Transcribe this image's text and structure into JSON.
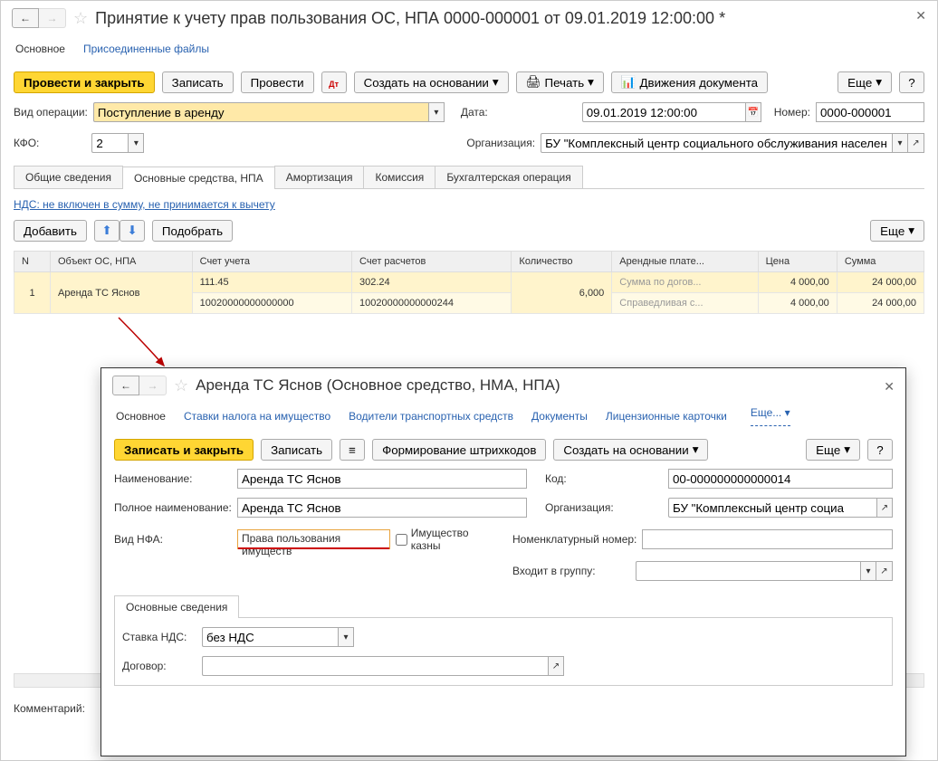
{
  "window": {
    "title": "Принятие к учету прав пользования ОС, НПА 0000-000001 от 09.01.2019 12:00:00 *",
    "nav_tabs": [
      "Основное",
      "Присоединенные файлы"
    ],
    "toolbar": {
      "post_close": "Провести и закрыть",
      "save": "Записать",
      "post": "Провести",
      "create_based": "Создать на основании",
      "print": "Печать",
      "movements": "Движения документа",
      "more": "Еще"
    },
    "fields": {
      "operation_type_label": "Вид операции:",
      "operation_type_value": "Поступление в аренду",
      "date_label": "Дата:",
      "date_value": "09.01.2019 12:00:00",
      "number_label": "Номер:",
      "number_value": "0000-000001",
      "kfo_label": "КФО:",
      "kfo_value": "2",
      "org_label": "Организация:",
      "org_value": "БУ \"Комплексный центр социального обслуживания населен"
    },
    "tabs": [
      "Общие сведения",
      "Основные средства, НПА",
      "Амортизация",
      "Комиссия",
      "Бухгалтерская операция"
    ],
    "vat_link": "НДС: не включен в сумму, не принимается к вычету",
    "sub_toolbar": {
      "add": "Добавить",
      "pick": "Подобрать",
      "more": "Еще"
    },
    "table": {
      "headers": [
        "N",
        "Объект ОС, НПА",
        "Счет учета",
        "Счет расчетов",
        "Количество",
        "Арендные плате...",
        "Цена",
        "Сумма"
      ],
      "rows": [
        {
          "n": "1",
          "obj": "Аренда ТС Яснов",
          "acct": "111.45",
          "settle": "302.24",
          "qty": "6,000",
          "rent": "Сумма по догов...",
          "price": "4 000,00",
          "sum": "24 000,00"
        },
        {
          "n": "",
          "obj": "",
          "acct": "10020000000000000",
          "settle": "10020000000000244",
          "qty": "",
          "rent": "Справедливая с...",
          "price": "4 000,00",
          "sum": "24 000,00"
        }
      ]
    },
    "comment_label": "Комментарий:"
  },
  "detail": {
    "title": "Аренда ТС Яснов (Основное средство, НМА, НПА)",
    "nav_tabs": [
      "Основное",
      "Ставки налога на имущество",
      "Водители транспортных средств",
      "Документы",
      "Лицензионные карточки",
      "Еще..."
    ],
    "toolbar": {
      "save_close": "Записать и закрыть",
      "save": "Записать",
      "barcode": "Формирование штрихкодов",
      "create_based": "Создать на основании",
      "more": "Еще"
    },
    "fields": {
      "name_label": "Наименование:",
      "name_value": "Аренда ТС Яснов",
      "fullname_label": "Полное наименование:",
      "fullname_value": "Аренда ТС Яснов",
      "nfa_label": "Вид НФА:",
      "nfa_value": "Права пользования имуществ",
      "treasury_label": "Имущество казны",
      "code_label": "Код:",
      "code_value": "00-000000000000014",
      "org_label": "Организация:",
      "org_value": "БУ \"Комплексный центр социа",
      "nomnum_label": "Номенклатурный номер:",
      "group_label": "Входит в группу:",
      "vat_rate_label": "Ставка НДС:",
      "vat_rate_value": "без НДС",
      "contract_label": "Договор:"
    },
    "tabs": [
      "Основные сведения"
    ]
  }
}
